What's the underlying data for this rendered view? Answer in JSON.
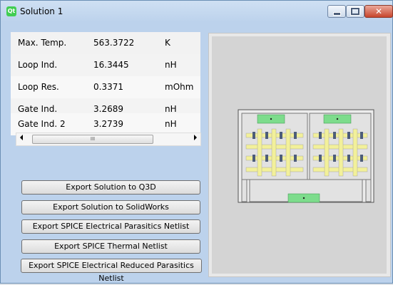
{
  "window": {
    "title": "Solution 1",
    "logo_text": "Qt"
  },
  "results": [
    {
      "name": "Max. Temp.",
      "value": "563.3722",
      "unit": "K"
    },
    {
      "name": "Loop Ind.",
      "value": "16.3445",
      "unit": "nH"
    },
    {
      "name": "Loop Res.",
      "value": "0.3371",
      "unit": "mOhm"
    },
    {
      "name": "Gate Ind.",
      "value": "3.2689",
      "unit": "nH"
    },
    {
      "name": "Gate Ind. 2",
      "value": "3.2739",
      "unit": "nH"
    }
  ],
  "scrollbar": {
    "thumb_grip": "III"
  },
  "buttons": {
    "export_q3d": "Export Solution to Q3D",
    "export_solidworks": "Export Solution to SolidWorks",
    "export_spice_parasitics": "Export SPICE Electrical Parasitics Netlist",
    "export_spice_thermal": "Export SPICE Thermal Netlist",
    "export_spice_reduced": "Export SPICE Electrical Reduced Parasitics Netlist"
  },
  "colors": {
    "accent_green": "#7ddc8c",
    "trace_yellow": "#f2f09a",
    "pad_blue": "#6b8fb5"
  }
}
